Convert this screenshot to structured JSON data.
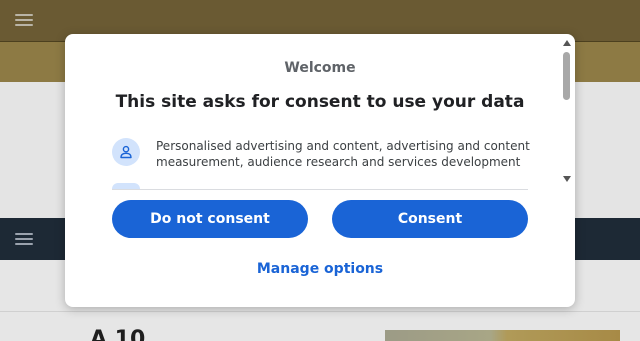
{
  "dialog": {
    "welcome": "Welcome",
    "title": "This site asks for consent to use your data",
    "purposes": [
      {
        "icon": "person-icon",
        "text": "Personalised advertising and content, advertising and content measurement, audience research and services development"
      }
    ],
    "buttons": {
      "do_not_consent": "Do not consent",
      "consent": "Consent",
      "manage_options": "Manage options"
    }
  },
  "background": {
    "heading_fragment": "A 10"
  },
  "colors": {
    "primary": "#1a64d6",
    "topbar": "#6a5a33",
    "band": "#8d7a44",
    "nav": "#1d2935",
    "icon_bg": "#d2e3fc"
  }
}
